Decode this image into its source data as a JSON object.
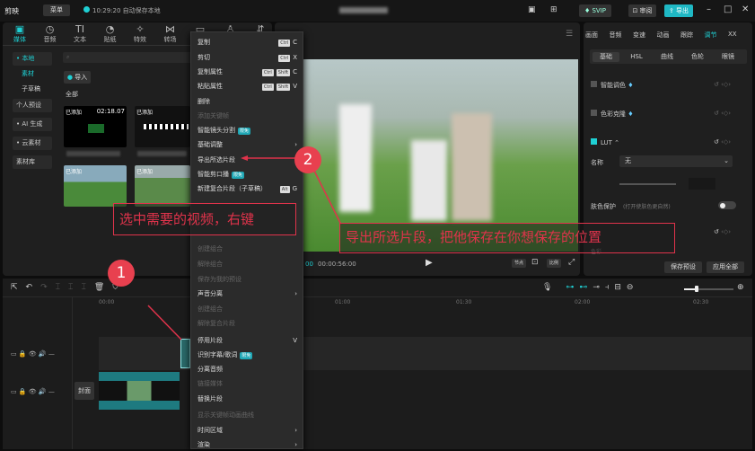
{
  "titlebar": {
    "logo": "剪映",
    "menu_label": "菜单",
    "autosave": "10:29:20 自动保存本地",
    "vip": "SVIP",
    "review": "审阅",
    "export": "导出"
  },
  "toolbar": {
    "tabs": [
      {
        "icon": "▣",
        "label": "媒体"
      },
      {
        "icon": "◷",
        "label": "音频"
      },
      {
        "icon": "TI",
        "label": "文本"
      },
      {
        "icon": "◔",
        "label": "贴纸"
      },
      {
        "icon": "✧",
        "label": "特效"
      },
      {
        "icon": "⋈",
        "label": "转场"
      },
      {
        "icon": "▭",
        "label": ""
      },
      {
        "icon": "♙",
        "label": ""
      },
      {
        "icon": "⇵",
        "label": ""
      }
    ]
  },
  "left_panel": {
    "sidebar": [
      "• 本地",
      "素材",
      "子草稿",
      "个人预设",
      "• AI 生成",
      "• 云素材",
      "素材库"
    ],
    "import_label": "导入",
    "all_label": "全部",
    "thumbs": [
      {
        "tag": "已添加",
        "duration": "02:18.07"
      },
      {
        "tag": "已添加",
        "duration": ""
      },
      {
        "tag": "已添加",
        "duration": ""
      },
      {
        "tag": "已添加",
        "duration": ""
      }
    ]
  },
  "preview": {
    "timecode": "00:00:56:00",
    "current": "00",
    "btn_a": "节点",
    "btn_b": "比例"
  },
  "right_panel": {
    "tabs": [
      "画面",
      "音频",
      "变速",
      "动画",
      "跟踪",
      "调节",
      "XX"
    ],
    "active_tab": "调节",
    "subtabs": [
      "基础",
      "HSL",
      "曲线",
      "色轮",
      "眼镜"
    ],
    "smart_color": "智能调色",
    "color_match": "色彩克隆",
    "lut": "LUT",
    "name_label": "名称",
    "name_value": "无",
    "skin_protect": "肤色保护",
    "skin_hint": "(打开使肤色更自然)",
    "color_label": "色彩",
    "save_preset": "保存预设",
    "apply_all": "应用全部"
  },
  "timeline": {
    "ruler": [
      "00:00",
      "01:00",
      "01:30",
      "02:00",
      "02:30"
    ],
    "cover": "封面"
  },
  "menu": {
    "items": [
      {
        "label": "复制",
        "keys": [
          "Ctrl"
        ],
        "key": "C"
      },
      {
        "label": "剪切",
        "keys": [
          "Ctrl"
        ],
        "key": "X"
      },
      {
        "label": "复制属性",
        "keys": [
          "Ctrl",
          "Shift"
        ],
        "key": "C"
      },
      {
        "label": "粘贴属性",
        "keys": [
          "Ctrl",
          "Shift"
        ],
        "key": "V"
      },
      {
        "label": "删除"
      },
      {
        "label": "添加关键帧",
        "disabled": true
      },
      {
        "label": "智能镜头分割",
        "badge": "限免"
      },
      {
        "label": "基础调整",
        "key": "›"
      },
      {
        "label": "导出所选片段"
      },
      {
        "label": "智能剪口播",
        "badge": "限免"
      },
      {
        "label": "新建复合片段（子草稿）",
        "keys": [
          "Alt"
        ],
        "key": "G"
      },
      {
        "label": "",
        "disabled": true
      },
      {
        "label": "",
        "disabled": true
      },
      {
        "label": "",
        "disabled": true
      },
      {
        "label": "创建组合",
        "disabled": true
      },
      {
        "label": "解除组合",
        "disabled": true
      },
      {
        "label": "保存为我的预设",
        "disabled": true
      },
      {
        "label": "声音分离",
        "key": "›"
      },
      {
        "label": "创建组合",
        "disabled": true
      },
      {
        "label": "解除复合片段",
        "disabled": true
      },
      {
        "label": "停用片段",
        "key": "V"
      },
      {
        "label": "识别字幕/歌词",
        "badge": "限免"
      },
      {
        "label": "分离音频"
      },
      {
        "label": "链接媒体",
        "disabled": true
      },
      {
        "label": "替换片段"
      },
      {
        "label": "显示关键帧动画曲线",
        "disabled": true
      },
      {
        "label": "时间区域",
        "key": "›"
      },
      {
        "label": "渲染",
        "key": "›"
      }
    ]
  },
  "annotations": {
    "step1": "1",
    "step2": "2",
    "text1": "选中需要的视频，右键",
    "text2": "导出所选片段，把他保存在你想保存的位置"
  },
  "colors": {
    "accent": "#1fd0d4",
    "annotation": "#e0334b"
  }
}
